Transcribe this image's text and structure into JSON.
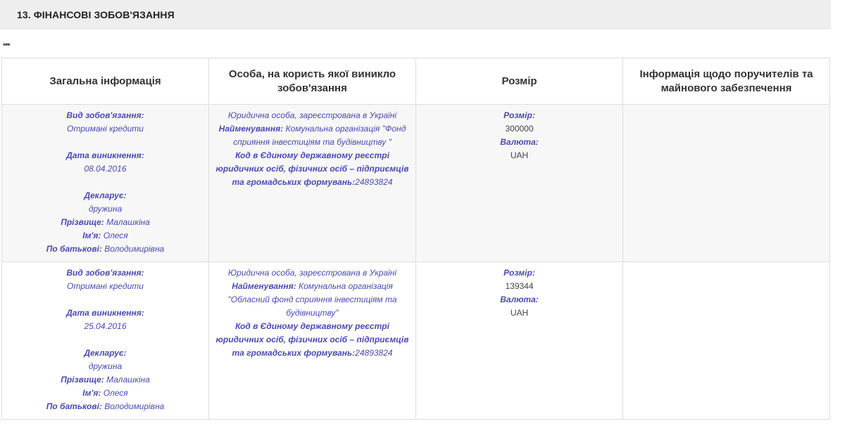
{
  "section": {
    "title": "13.  ФІНАНСОВІ ЗОБОВ'ЯЗАННЯ",
    "more": "•••"
  },
  "table": {
    "headers": [
      "Загальна інформація",
      "Особа, на користь якої виникло зобов'язання",
      "Розмір",
      "Інформація щодо поручителів та майнового забезпечення"
    ],
    "rows": [
      {
        "type_label": "Вид зобов'язання:",
        "type_value": "Отримані кредити",
        "date_label": "Дата виникнення:",
        "date_value": "08.04.2016",
        "declarant_label": "Декларує:",
        "declarant_value": "дружина",
        "surname_label": "Прізвище:",
        "surname_value": "Малашкіна",
        "name_label": "Ім'я:",
        "name_value": "Олеся",
        "patronymic_label": "По батькові:",
        "patronymic_value": "Володимирівна",
        "creditor_type": "Юридична особа, зареєстрована в Україні",
        "creditor_name_label": "Найменування:",
        "creditor_name_value": "Комунальна організація \"Фонд сприяння інвестиціям та будівництву \"",
        "creditor_code_label": "Код в Єдиному державному реєстрі юридичних осіб, фізичних осіб – підприємців та громадських формувань:",
        "creditor_code_value": "24893824",
        "amount_label": "Розмір:",
        "amount_value": "300000",
        "currency_label": "Валюта:",
        "currency_value": "UAH",
        "guarantors": ""
      },
      {
        "type_label": "Вид зобов'язання:",
        "type_value": "Отримані кредити",
        "date_label": "Дата виникнення:",
        "date_value": "25.04.2016",
        "declarant_label": "Декларує:",
        "declarant_value": "дружина",
        "surname_label": "Прізвище:",
        "surname_value": "Малашкіна",
        "name_label": "Ім'я:",
        "name_value": "Олеся",
        "patronymic_label": "По батькові:",
        "patronymic_value": "Володимирівна",
        "creditor_type": "Юридична особа, зареєстрована в Україні",
        "creditor_name_label": "Найменування:",
        "creditor_name_value": "Комунальна організація \"Обласний фонд сприяння інвестиціям та будівництву\"",
        "creditor_code_label": "Код в Єдиному державному реєстрі юридичних осіб, фізичних осіб – підприємців та громадських формувань:",
        "creditor_code_value": "24893824",
        "amount_label": "Розмір:",
        "amount_value": "139344",
        "currency_label": "Валюта:",
        "currency_value": "UAH",
        "guarantors": ""
      }
    ]
  }
}
